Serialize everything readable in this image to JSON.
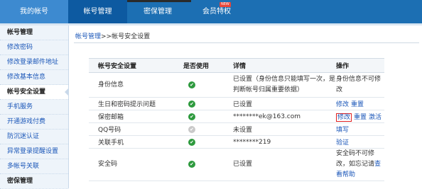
{
  "nav": {
    "home": "我的帐号",
    "account": "帐号管理",
    "secret": "密保管理",
    "vip": "会员特权",
    "vip_badge": "NEW"
  },
  "sidebar": {
    "items": [
      {
        "label": "帐号管理"
      },
      {
        "label": "修改密码"
      },
      {
        "label": "修改登录邮件地址"
      },
      {
        "label": "修改基本信息"
      },
      {
        "label": "帐号安全设置"
      },
      {
        "label": "手机服务"
      },
      {
        "label": "开通游戏付费"
      },
      {
        "label": "防沉迷认证"
      },
      {
        "label": "异常登录提醒设置"
      },
      {
        "label": "多帐号关联"
      },
      {
        "label": "密保管理"
      }
    ]
  },
  "breadcrumb": {
    "link": "帐号管理",
    "sep": ">>",
    "current": "帐号安全设置"
  },
  "table": {
    "headers": [
      "帐号安全设置",
      "是否使用",
      "详情",
      "操作"
    ],
    "rows": [
      {
        "name": "身份信息",
        "detail": "已设置（身份信息只能填写一次，是判断帐号归属重要依据）",
        "ops_text": "身份信息不可修改"
      },
      {
        "name": "生日和密码提示问题",
        "detail": "已设置",
        "op1": "修改",
        "op2": "重置"
      },
      {
        "name": "保密邮箱",
        "detail": "********ek@163.com",
        "op1": "修改",
        "op2": "重置",
        "op3": "激活"
      },
      {
        "name": "QQ号码",
        "detail": "未设置",
        "op1": "填写"
      },
      {
        "name": "关联手机",
        "detail": "********219",
        "op1": "验证"
      },
      {
        "name": "安全码",
        "detail": "已设置",
        "ops_text": "安全码不可修改，如忘记请",
        "op_link": "查看帮助"
      }
    ]
  },
  "colors": {
    "nav_bg": "#1c6fb3",
    "active_tab": "#0d5aa1",
    "check_green": "#2e9a3e",
    "check_gray": "#c9c9c9",
    "link": "#1a56b8",
    "highlight_border": "#e02020"
  },
  "icons": {
    "in_use": "check-circle-icon",
    "not_used": "check-circle-gray-icon"
  }
}
